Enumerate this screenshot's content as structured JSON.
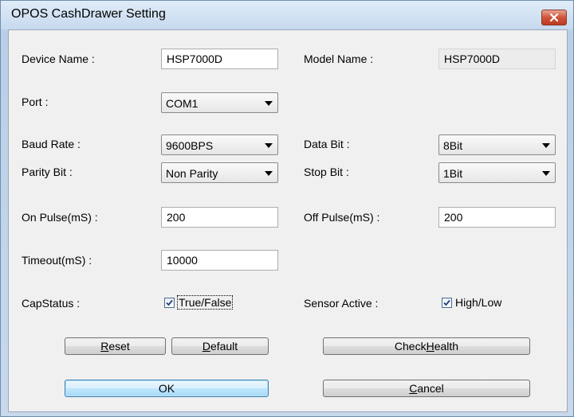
{
  "window": {
    "title": "OPOS CashDrawer Setting"
  },
  "fields": {
    "device_name": {
      "label": "Device Name :",
      "value": "HSP7000D"
    },
    "model_name": {
      "label": "Model Name :",
      "value": "HSP7000D"
    },
    "port": {
      "label": "Port :",
      "value": "COM1"
    },
    "baud_rate": {
      "label": "Baud Rate :",
      "value": "9600BPS"
    },
    "data_bit": {
      "label": "Data Bit :",
      "value": "8Bit"
    },
    "parity_bit": {
      "label": "Parity Bit :",
      "value": "Non Parity"
    },
    "stop_bit": {
      "label": "Stop Bit :",
      "value": "1Bit"
    },
    "on_pulse": {
      "label": "On Pulse(mS) :",
      "value": "200"
    },
    "off_pulse": {
      "label": "Off Pulse(mS) :",
      "value": "200"
    },
    "timeout": {
      "label": "Timeout(mS) :",
      "value": "10000"
    },
    "cap_status": {
      "label": "CapStatus :",
      "option": "True/False",
      "checked": true
    },
    "sensor_active": {
      "label": "Sensor Active :",
      "option": "High/Low",
      "checked": true
    }
  },
  "buttons": {
    "reset": {
      "label": "Reset",
      "mnemonic": "R",
      "rest": "eset"
    },
    "default": {
      "label": "Default",
      "mnemonic": "D",
      "rest": "efault"
    },
    "check_health": {
      "label": "CheckHealth",
      "pre": "Check",
      "mnemonic": "H",
      "rest": "ealth"
    },
    "ok": {
      "label": "OK"
    },
    "cancel": {
      "label": "Cancel",
      "mnemonic": "C",
      "rest": "ancel"
    }
  },
  "icons": {
    "close": "close-icon",
    "checkbox": "checkmark-icon",
    "dropdown": "chevron-down-icon"
  },
  "colors": {
    "accent": "#3c7fb1",
    "close": "#c8452c",
    "window_frame": "#c9d9ea"
  }
}
